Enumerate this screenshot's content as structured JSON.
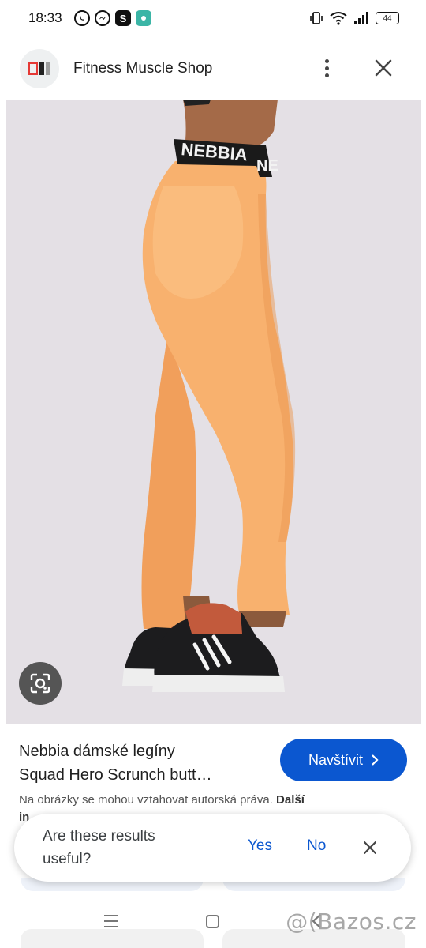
{
  "status_bar": {
    "time": "18:33",
    "battery": "44",
    "app_icons": [
      "whatsapp-icon",
      "messenger-icon",
      "s-app-icon",
      "teal-app-icon"
    ],
    "s_app_letter": "S"
  },
  "header": {
    "site_name": "Fitness Muscle Shop",
    "logo_colors": [
      "#e53935",
      "#222222",
      "#9e9e9e"
    ]
  },
  "image": {
    "waistband_text": "NEBBIA",
    "waistband_text_back": "NE",
    "colors": {
      "background": "#e4e0e5",
      "leggings": "#f8b16e",
      "skin": "#a46a48",
      "shoe": "#1c1c1e",
      "sole": "#eeeeee"
    }
  },
  "result": {
    "title_line1": "Nebbia dámské legíny",
    "title_line2": "Squad Hero Scrunch butt…",
    "visit_label": "Navštívit",
    "copyright_text": "Na obrázky se mohou vztahovat autorská práva.",
    "copyright_more": "Další",
    "copyright_more_cut": "in"
  },
  "feedback": {
    "question": "Are these results useful?",
    "yes_label": "Yes",
    "no_label": "No"
  },
  "watermark": "@(Bazos.cz",
  "colors": {
    "accent": "#0b57d0",
    "text": "#1f1f1f"
  }
}
